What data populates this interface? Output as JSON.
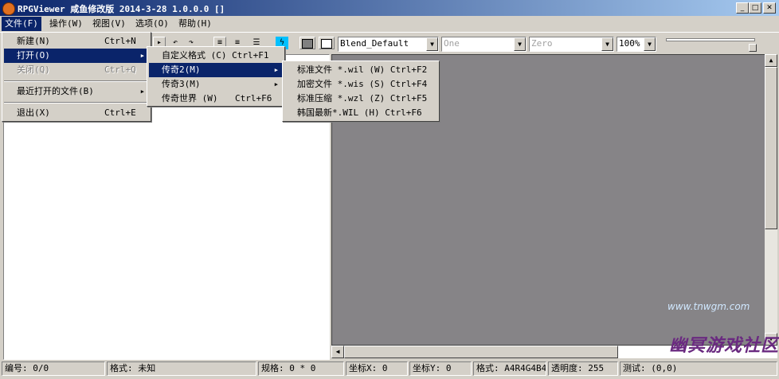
{
  "window": {
    "title": "RPGViewer 咸鱼修改版 2014-3-28 1.0.0.0 []"
  },
  "menubar": [
    {
      "label": "文件(F)"
    },
    {
      "label": "操作(W)"
    },
    {
      "label": "视图(V)"
    },
    {
      "label": "选项(O)"
    },
    {
      "label": "帮助(H)"
    }
  ],
  "toolbar": {
    "blend_combo": "Blend_Default",
    "one_combo": "One",
    "zero_combo": "Zero",
    "zoom_combo": "100%"
  },
  "file_menu": [
    {
      "label": "新建(N)",
      "shortcut": "Ctrl+N"
    },
    {
      "label": "打开(O)",
      "shortcut": ""
    },
    {
      "label": "关闭(Q)",
      "shortcut": "Ctrl+Q"
    },
    {
      "label": "最近打开的文件(B)",
      "shortcut": ""
    },
    {
      "label": "退出(X)",
      "shortcut": "Ctrl+E"
    }
  ],
  "open_menu": [
    {
      "label": "自定义格式 (C) Ctrl+F1"
    },
    {
      "label": "传奇2(M)"
    },
    {
      "label": "传奇3(M)"
    },
    {
      "label": "传奇世界 (W)",
      "shortcut": "Ctrl+F6"
    }
  ],
  "legend2_menu": [
    {
      "label": "标准文件 *.wil (W) Ctrl+F2"
    },
    {
      "label": "加密文件 *.wis (S) Ctrl+F4"
    },
    {
      "label": "标准压缩 *.wzl (Z) Ctrl+F5"
    },
    {
      "label": "韩国最新*.WIL (H)  Ctrl+F6"
    }
  ],
  "statusbar": [
    {
      "label": "编号: 0/0"
    },
    {
      "label": "格式: 未知"
    },
    {
      "label": "规格: 0 * 0"
    },
    {
      "label": "坐标X: 0"
    },
    {
      "label": "坐标Y: 0"
    },
    {
      "label": "格式: A4R4G4B4"
    },
    {
      "label": "透明度: 255"
    },
    {
      "label": "测试: (0,0)"
    }
  ],
  "watermark": {
    "text": "幽冥游戏社区",
    "url": "www.tnwgm.com"
  },
  "colors": {
    "titlebar": "#0a246a",
    "highlight": "#0a246a",
    "canvas": "#868487",
    "face": "#d4d0c8"
  }
}
